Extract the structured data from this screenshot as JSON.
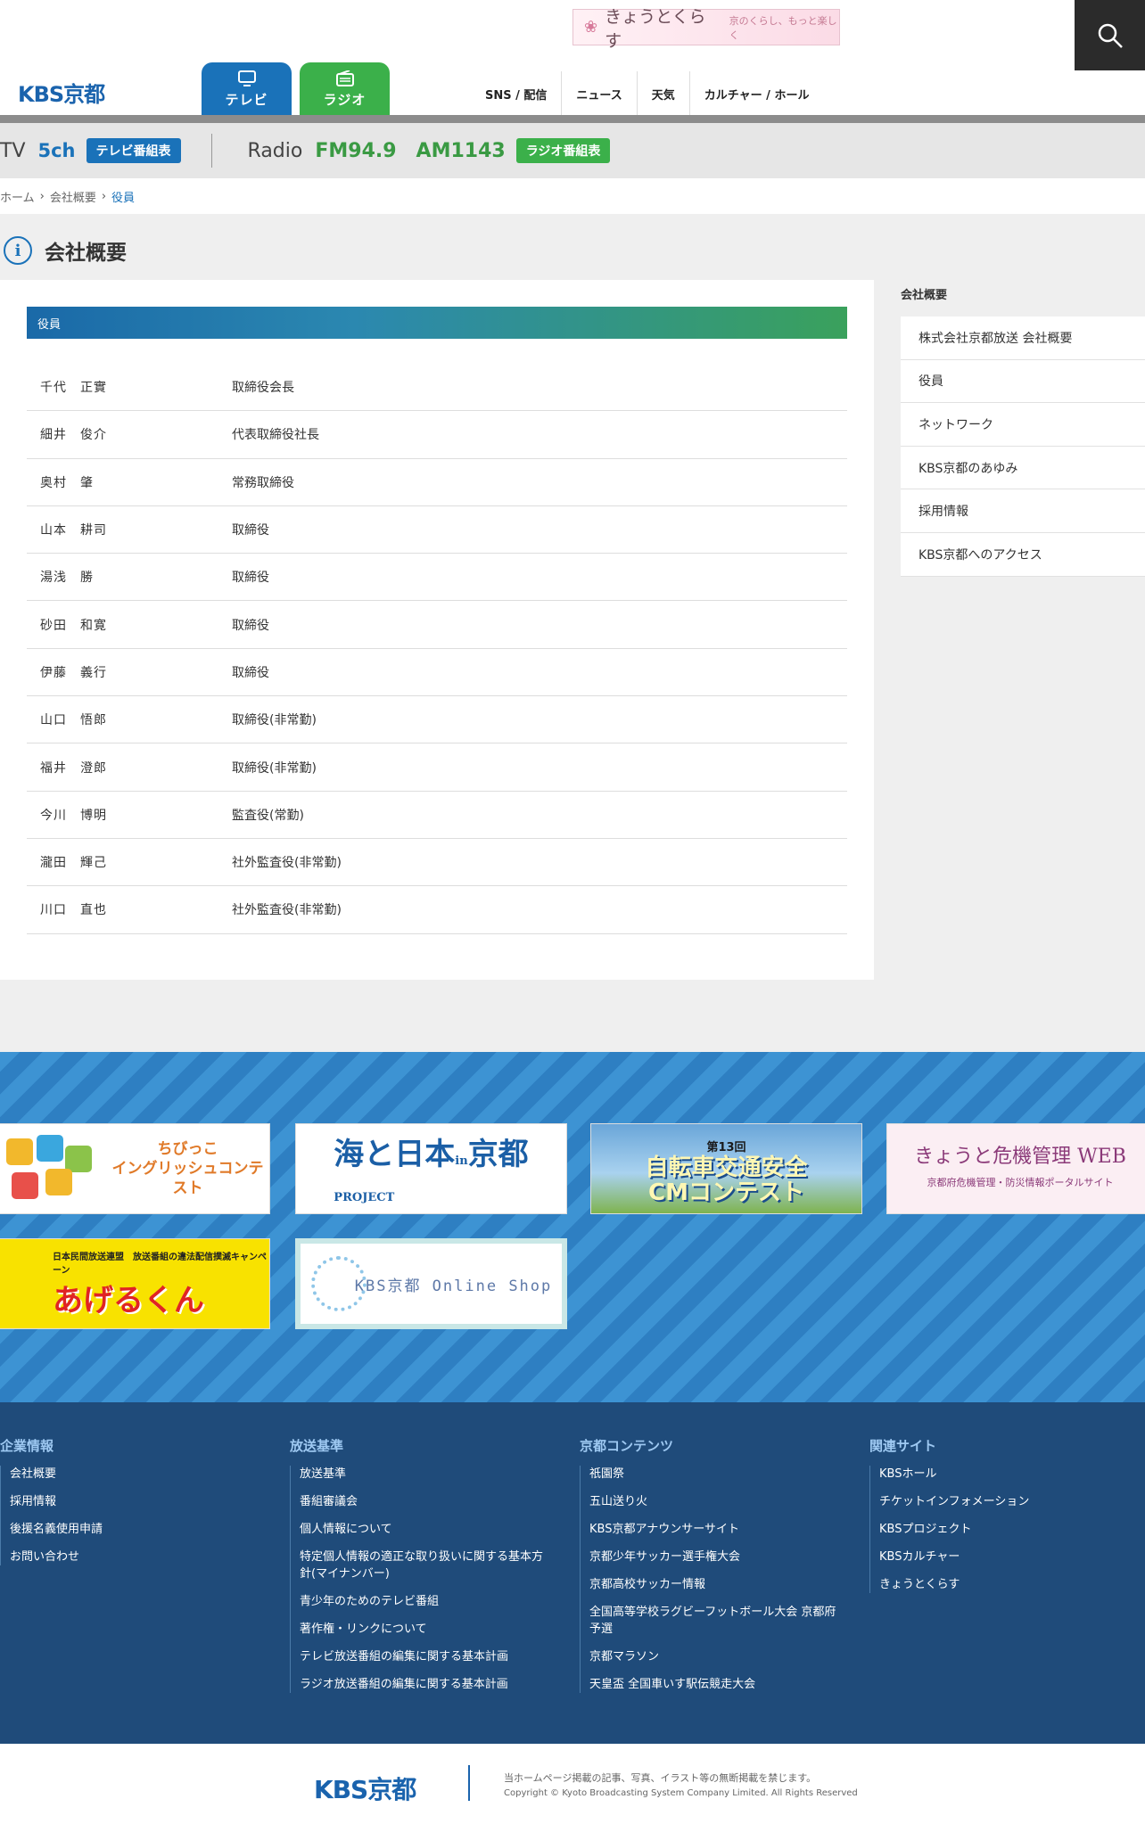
{
  "header": {
    "promo_title": "きょうとくらす",
    "promo_tag": "京のくらし、もっと楽しく",
    "logo": "KBS京都",
    "tabs": [
      {
        "label": "テレビ"
      },
      {
        "label": "ラジオ"
      }
    ],
    "nav": [
      "SNS / 配信",
      "ニュース",
      "天気",
      "カルチャー / ホール"
    ]
  },
  "channel_bar": {
    "tv_label": "TV",
    "tv_channel": "5ch",
    "tv_button": "テレビ番組表",
    "radio_label": "Radio",
    "fm": "FM94.9",
    "am": "AM1143",
    "radio_button": "ラジオ番組表"
  },
  "breadcrumb": {
    "items": [
      "ホーム",
      "会社概要"
    ],
    "current": "役員"
  },
  "page_title": "会社概要",
  "section_heading": "役員",
  "officers": [
    {
      "name": "千代　正實",
      "title": "取締役会長"
    },
    {
      "name": "細井　俊介",
      "title": "代表取締役社長"
    },
    {
      "name": "奥村　肇",
      "title": "常務取締役"
    },
    {
      "name": "山本　耕司",
      "title": "取締役"
    },
    {
      "name": "湯浅　勝",
      "title": "取締役"
    },
    {
      "name": "砂田　和寛",
      "title": "取締役"
    },
    {
      "name": "伊藤　義行",
      "title": "取締役"
    },
    {
      "name": "山口　悟郎",
      "title": "取締役(非常勤)"
    },
    {
      "name": "福井　澄郎",
      "title": "取締役(非常勤)"
    },
    {
      "name": "今川　博明",
      "title": "監査役(常勤)"
    },
    {
      "name": "瀧田　輝己",
      "title": "社外監査役(非常勤)"
    },
    {
      "name": "川口　直也",
      "title": "社外監査役(非常勤)"
    }
  ],
  "sidebar": {
    "title": "会社概要",
    "items": [
      "株式会社京都放送 会社概要",
      "役員",
      "ネットワーク",
      "KBS京都のあゆみ",
      "採用情報",
      "KBS京都へのアクセス"
    ]
  },
  "banners": {
    "english": "ちびっこ\nイングリッシュコンテスト",
    "umi": "海と日本",
    "umi_in": "in",
    "umi_kyoto": "京都",
    "umi_project": "PROJECT",
    "cycle_pre": "第13回",
    "cycle_title": "自転車交通安全",
    "cycle_cm": "CMコンテスト",
    "kiki_title": "きょうと危機管理 WEB",
    "kiki_sub": "京都府危機管理・防災情報ポータルサイト",
    "ageru_pre": "日本民間放送連盟　放送番組の違法配信撲滅キャンペーン",
    "ageru": "あげるくん",
    "shop": "KBS京都 Online Shop"
  },
  "footer": {
    "columns": [
      {
        "title": "企業情報",
        "links": [
          "会社概要",
          "採用情報",
          "後援名義使用申請",
          "お問い合わせ"
        ]
      },
      {
        "title": "放送基準",
        "links": [
          "放送基準",
          "番組審議会",
          "個人情報について",
          "特定個人情報の適正な取り扱いに関する基本方針(マイナンバー)",
          "青少年のためのテレビ番組",
          "著作権・リンクについて",
          "テレビ放送番組の編集に関する基本計画",
          "ラジオ放送番組の編集に関する基本計画"
        ]
      },
      {
        "title": "京都コンテンツ",
        "links": [
          "祇園祭",
          "五山送り火",
          "KBS京都アナウンサーサイト",
          "京都少年サッカー選手権大会",
          "京都高校サッカー情報",
          "全国高等学校ラグビーフットボール大会 京都府予選",
          "京都マラソン",
          "天皇盃 全国車いす駅伝競走大会"
        ]
      },
      {
        "title": "関連サイト",
        "links": [
          "KBSホール",
          "チケットインフォメーション",
          "KBSプロジェクト",
          "KBSカルチャー",
          "きょうとくらす"
        ]
      }
    ],
    "logo": "KBS京都",
    "notice": "当ホームページ掲載の記事、写真、イラスト等の無断掲載を禁じます。",
    "copyright": "Copyright © Kyoto Broadcasting System Company Limited. All Rights Reserved"
  }
}
